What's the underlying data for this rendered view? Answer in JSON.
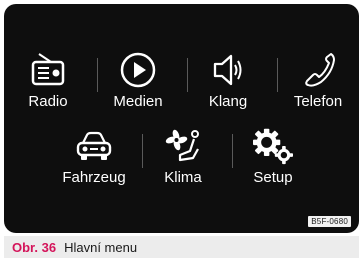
{
  "menu": {
    "items": [
      {
        "label": "Radio",
        "icon": "radio-icon"
      },
      {
        "label": "Medien",
        "icon": "play-circle-icon"
      },
      {
        "label": "Klang",
        "icon": "speaker-icon"
      },
      {
        "label": "Telefon",
        "icon": "phone-icon"
      },
      {
        "label": "Fahrzeug",
        "icon": "car-icon"
      },
      {
        "label": "Klima",
        "icon": "fan-seat-icon"
      },
      {
        "label": "Setup",
        "icon": "gears-icon"
      }
    ]
  },
  "screen_code": "B5F-0680",
  "caption": {
    "figure": "Obr. 36",
    "title": "Hlavní menu"
  },
  "colors": {
    "screen_bg": "#0e0e0e",
    "caption_accent": "#d4145a",
    "caption_bg": "#ececec"
  }
}
